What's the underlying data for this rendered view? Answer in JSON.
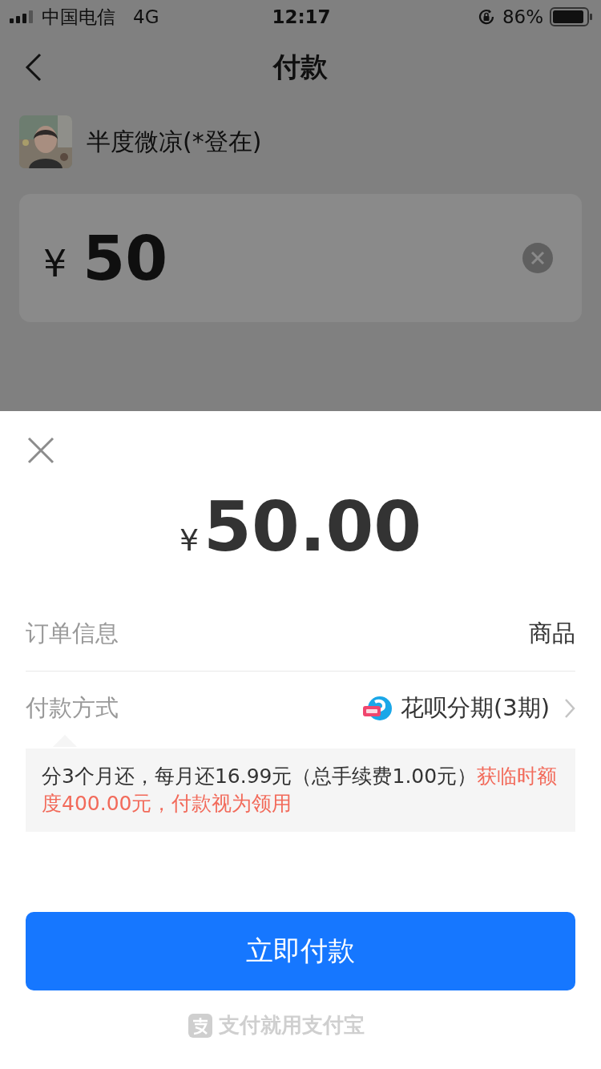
{
  "status_bar": {
    "carrier": "中国电信",
    "network": "4G",
    "time": "12:17",
    "battery": "86%"
  },
  "nav": {
    "title": "付款"
  },
  "payee": {
    "name": "半度微凉(*登在)"
  },
  "amount_field": {
    "currency": "¥",
    "value": "50"
  },
  "sheet": {
    "amount": {
      "currency": "¥",
      "value": "50.00"
    },
    "rows": [
      {
        "label": "订单信息",
        "value": "商品",
        "kind": "plain"
      },
      {
        "label": "付款方式",
        "value": "花呗分期(3期)",
        "kind": "method"
      }
    ],
    "note": [
      {
        "text": "分3个月还，每月还16.99元（总手续费1.00元）",
        "kind": "normal"
      },
      {
        "text": "获临时额度400.00元，付款视为领用",
        "kind": "highlight"
      }
    ],
    "pay_button": "立即付款",
    "footer": "支付就用支付宝"
  }
}
